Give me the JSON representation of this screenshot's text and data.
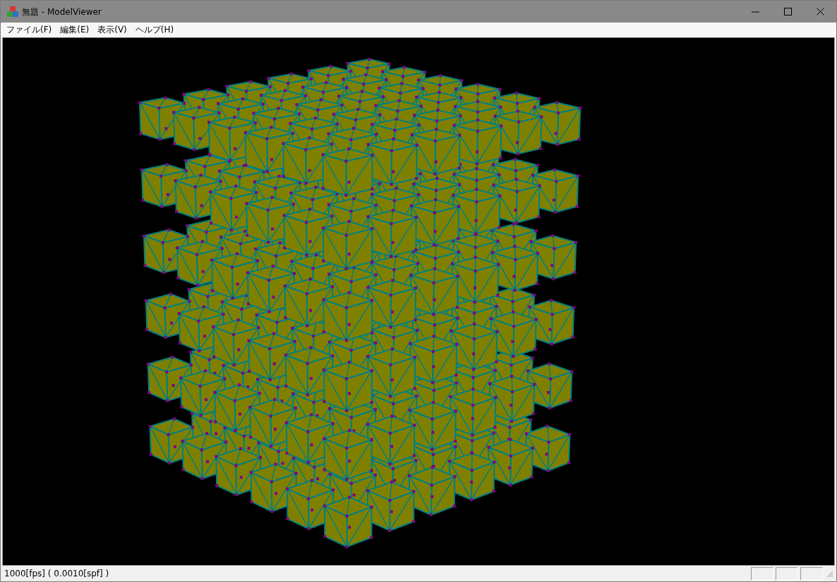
{
  "window": {
    "title": "無題 - ModelViewer"
  },
  "menu": [
    {
      "label": "ファイル(F)"
    },
    {
      "label": "編集(E)"
    },
    {
      "label": "表示(V)"
    },
    {
      "label": "ヘルプ(H)"
    }
  ],
  "status_bar": {
    "text": "1000[fps] ( 0.0010[spf] )"
  }
}
